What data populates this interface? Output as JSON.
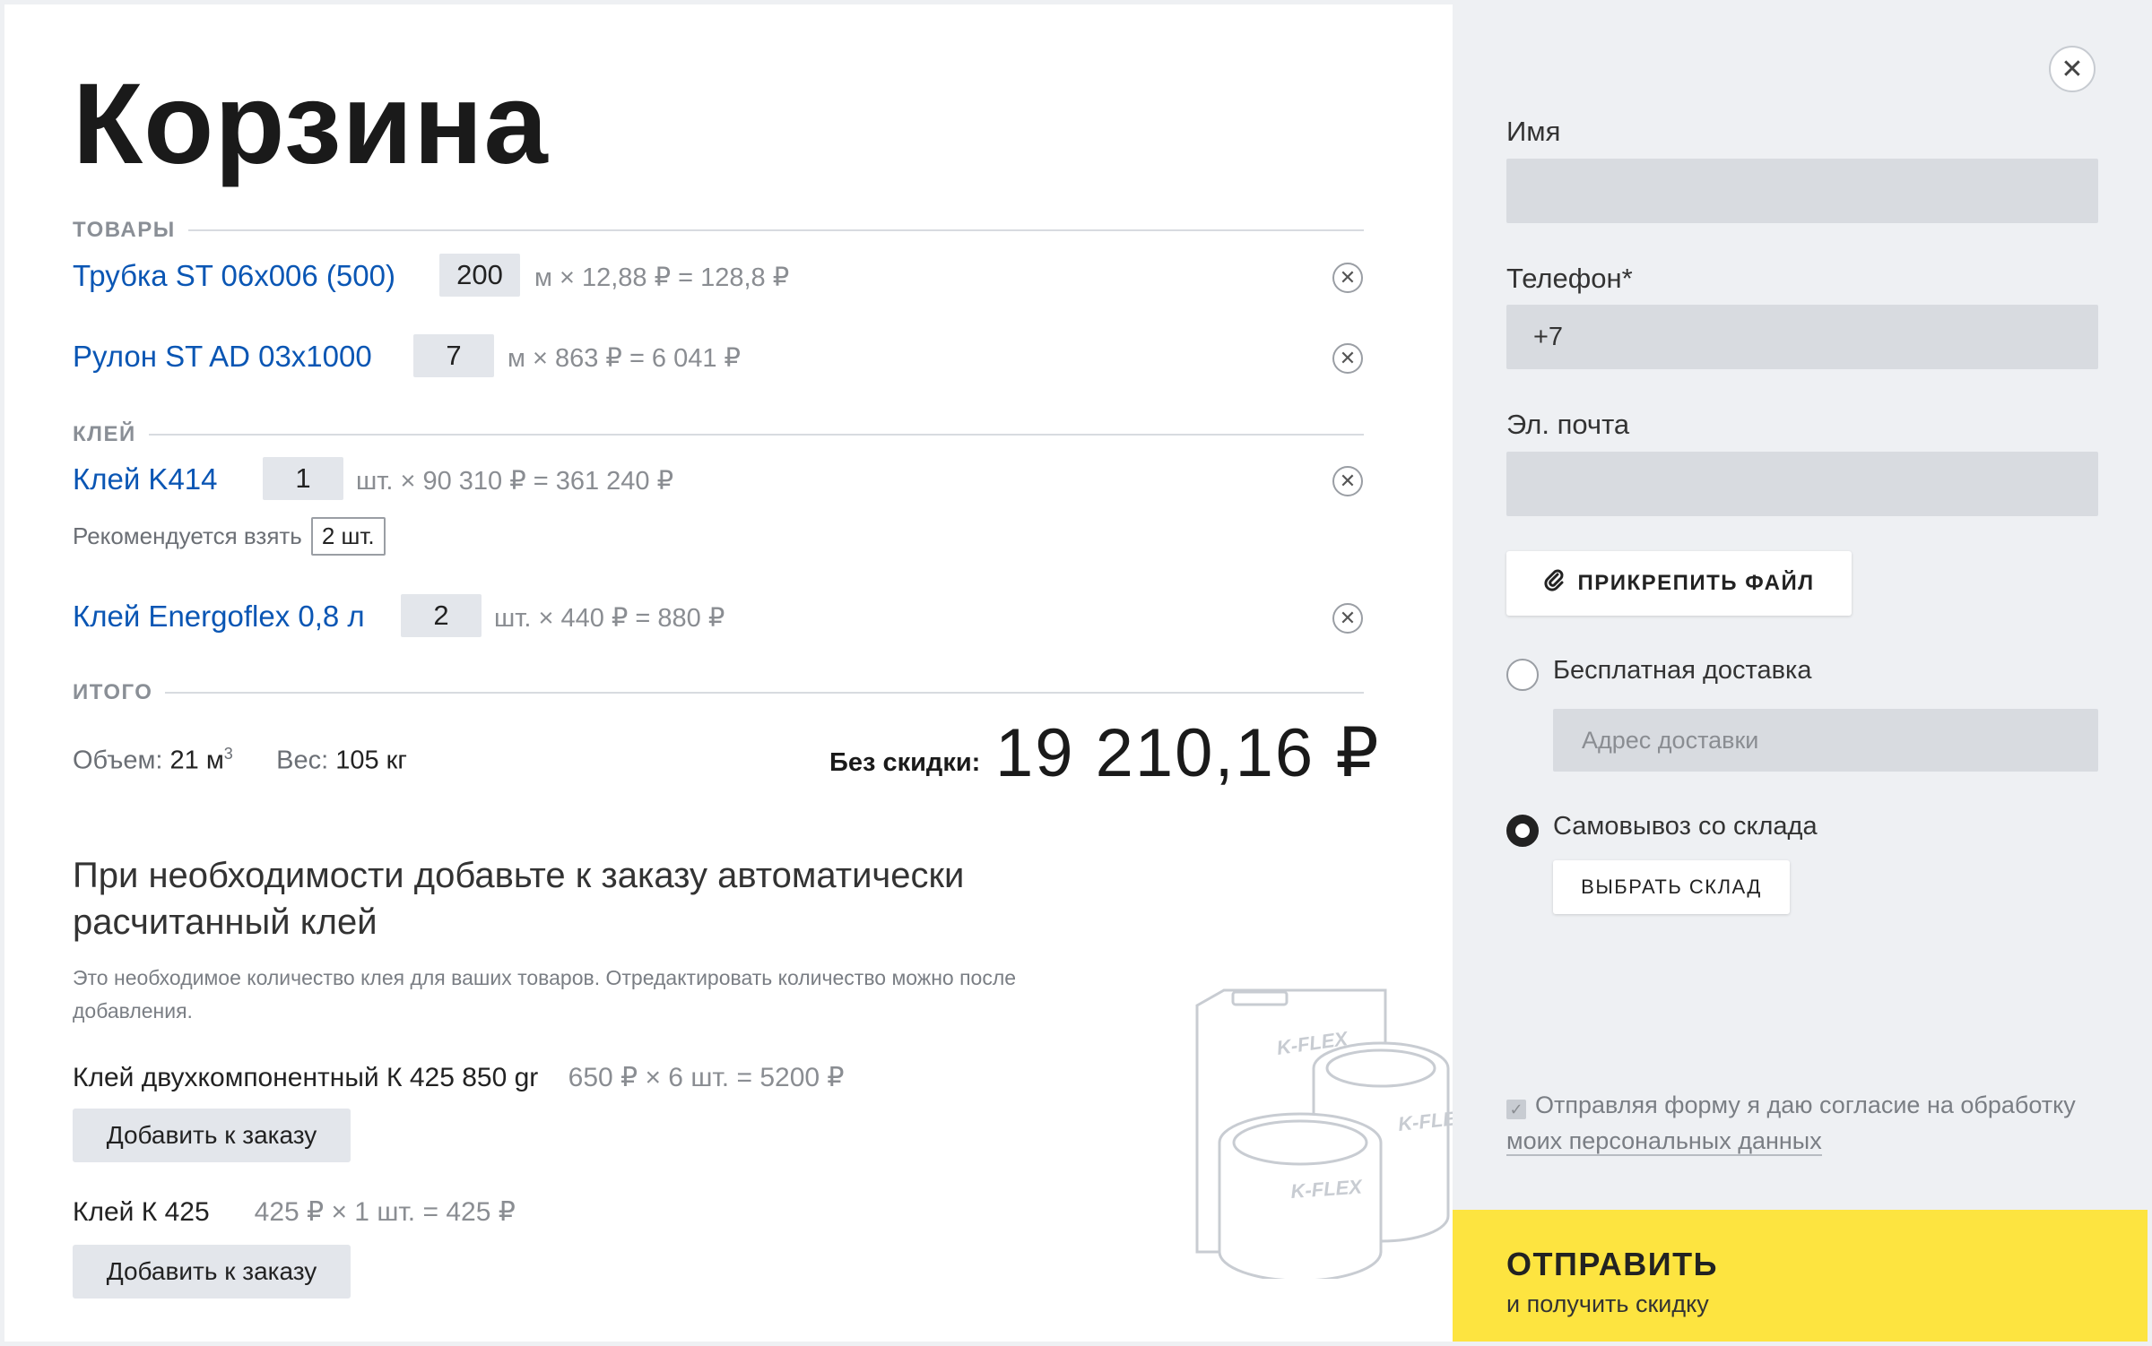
{
  "title": "Корзина",
  "sections": {
    "goods": "ТОВАРЫ",
    "glue": "КЛЕЙ",
    "total": "ИТОГО"
  },
  "items": [
    {
      "name": "Трубка ST 06x006 (500)",
      "qty": "200",
      "calc": "м × 12,88 ₽ = 128,8 ₽"
    },
    {
      "name": "Рулон ST AD 03x1000",
      "qty": "7",
      "calc": "м × 863 ₽ = 6 041 ₽"
    },
    {
      "name": "Клей K414",
      "qty": "1",
      "calc": "шт. × 90 310 ₽ = 361 240 ₽"
    },
    {
      "name": "Клей Energoflex 0,8 л",
      "qty": "2",
      "calc": "шт. × 440 ₽ = 880 ₽"
    }
  ],
  "recommend": {
    "label": "Рекомендуется взять",
    "value": "2 шт."
  },
  "summary": {
    "volume_label": "Объем:",
    "volume_value": "21 м",
    "volume_sup": "3",
    "weight_label": "Вес:",
    "weight_value": "105 кг",
    "total_label": "Без скидки:",
    "total_value": "19 210,16 ₽"
  },
  "promo": {
    "title": "При необходимости добавьте к заказу автоматически расчитанный клей",
    "subtitle": "Это необходимое количество клея для ваших товаров. Отредактировать количество можно после добавления.",
    "glues": [
      {
        "name": "Клей двухкомпонентный К 425 850 gr",
        "price": "650 ₽  ×  6 шт.  =  5200 ₽",
        "button": "Добавить к заказу"
      },
      {
        "name": "Клей К 425",
        "price": "425 ₽  ×  1 шт.  =  425 ₽",
        "button": "Добавить к заказу"
      }
    ],
    "can_brand": "K-FLEX"
  },
  "form": {
    "name_label": "Имя",
    "name_value": "",
    "phone_label": "Телефон*",
    "phone_value": "+7",
    "email_label": "Эл. почта",
    "email_value": "",
    "attach_label": "ПРИКРЕПИТЬ ФАЙЛ",
    "delivery_label": "Бесплатная доставка",
    "address_placeholder": "Адрес доставки",
    "pickup_label": "Самовывоз со склада",
    "warehouse_button": "ВЫБРАТЬ СКЛАД",
    "consent_text": "Отправляя форму я даю согласие на обработку",
    "consent_link": "моих персональных данных",
    "submit_main": "ОТПРАВИТЬ",
    "submit_sub": "и получить скидку"
  },
  "colors": {
    "accent_yellow": "#fde440",
    "link_blue": "#0a56b4"
  }
}
